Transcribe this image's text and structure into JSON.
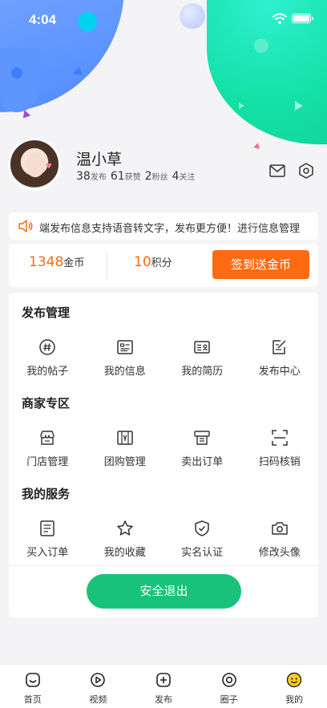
{
  "status_bar": {
    "time": "4:04"
  },
  "profile": {
    "name": "温小草",
    "stats": [
      {
        "value": "38",
        "label": "发布"
      },
      {
        "value": "61",
        "label": "获赞"
      },
      {
        "value": "2",
        "label": "粉丝"
      },
      {
        "value": "4",
        "label": "关注"
      }
    ]
  },
  "notice": {
    "text": "端发布信息支持语音转文字，发布更方便！进行信息管理"
  },
  "points": {
    "coins_value": "1348",
    "coins_label": "金币",
    "score_value": "10",
    "score_label": "积分",
    "signin_label": "签到送金币"
  },
  "sections": [
    {
      "title": "发布管理",
      "items": [
        {
          "label": "我的帖子",
          "icon": "hashtag-icon"
        },
        {
          "label": "我的信息",
          "icon": "info-card-icon"
        },
        {
          "label": "我的简历",
          "icon": "resume-icon"
        },
        {
          "label": "发布中心",
          "icon": "edit-icon"
        }
      ]
    },
    {
      "title": "商家专区",
      "items": [
        {
          "label": "门店管理",
          "icon": "store-icon"
        },
        {
          "label": "团购管理",
          "icon": "group-buy-icon"
        },
        {
          "label": "卖出订单",
          "icon": "sold-order-icon"
        },
        {
          "label": "扫码核销",
          "icon": "scan-icon"
        }
      ]
    },
    {
      "title": "我的服务",
      "items": [
        {
          "label": "买入订单",
          "icon": "order-list-icon"
        },
        {
          "label": "我的收藏",
          "icon": "star-icon"
        },
        {
          "label": "实名认证",
          "icon": "shield-check-icon"
        },
        {
          "label": "修改头像",
          "icon": "camera-icon"
        }
      ]
    }
  ],
  "logout_label": "安全退出",
  "tabs": [
    {
      "label": "首页",
      "icon": "home-icon"
    },
    {
      "label": "视频",
      "icon": "video-icon"
    },
    {
      "label": "发布",
      "icon": "add-icon"
    },
    {
      "label": "圈子",
      "icon": "circle-icon"
    },
    {
      "label": "我的",
      "icon": "smiley-icon"
    }
  ],
  "colors": {
    "accent_orange": "#ff6a13",
    "logout_green": "#18c27a"
  }
}
